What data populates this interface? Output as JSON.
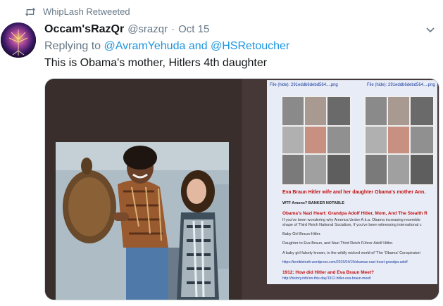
{
  "retweet": {
    "icon": "retweet-icon",
    "label": "WhipLash Retweeted"
  },
  "tweet": {
    "display_name": "Occam'sRazQr",
    "handle": "@srazqr",
    "separator": "·",
    "time": "Oct 15",
    "reply_prefix": "Replying to ",
    "reply_user_1": "@AvramYehuda",
    "reply_and": " and ",
    "reply_user_2": "@HSRetoucher",
    "text": "This is Obama's mother, Hitlers 4th daughter"
  },
  "media": {
    "right_doc": {
      "file_label_1": "File (hide): 291eddb6debd564....png",
      "file_label_2": "File (hide): 291eddb6debd564....png",
      "caption": "Eva Braun Hitler wife and her daughter Obama's mother Ann.",
      "line_1": "WTF Amons? BANKER NOTABLE",
      "heading": "Obama's Nazi Heart: Grandpa Adolf Hitler, Mom, And The Stealth R",
      "para_1": "If you've been wondering why America Under A.k.a. Obama increasing resemble",
      "para_2": "shape of Third Reich National Socialism, If you've been witnessing international c",
      "line_2": "Baby Girl Braun-Hitler.",
      "line_3": "Daughter to Eva Braun, and Nazi Third Reich Führer Adolf Hitler.",
      "line_4": "A baby girl falsely known, in the wildly wicked world of 'The 'Obama' Conspiratori",
      "link_1": "https://terribletruth.wordpress.com/2015/04/19/obamas-nazi-heart-grandpa-adolf",
      "heading_2": "1912: How did Hitler and Eva Braun Meet?",
      "link_2": "http://history.info/on-this-day/1912-hitler-eva-braun-meet/"
    }
  },
  "colors": {
    "link": "#1b95e0",
    "muted": "#657786",
    "text": "#14171a"
  }
}
